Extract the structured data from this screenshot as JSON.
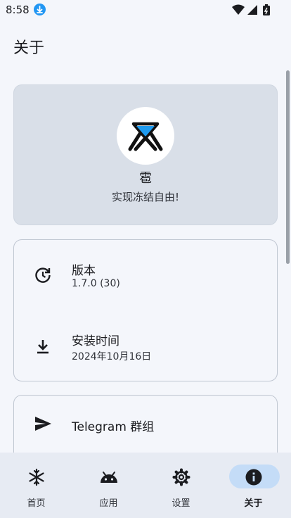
{
  "status": {
    "time": "8:58"
  },
  "header": {
    "title": "关于"
  },
  "hero": {
    "app_name": "雹",
    "slogan": "实现冻结自由!"
  },
  "info": {
    "version_label": "版本",
    "version_value": "1.7.0 (30)",
    "install_label": "安装时间",
    "install_value": "2024年10月16日"
  },
  "links": {
    "telegram_label": "Telegram 群组"
  },
  "nav": {
    "items": [
      {
        "label": "首页",
        "icon": "snowflake-icon"
      },
      {
        "label": "应用",
        "icon": "android-icon"
      },
      {
        "label": "设置",
        "icon": "gear-icon"
      },
      {
        "label": "关于",
        "icon": "info-icon",
        "active": true
      }
    ]
  },
  "colors": {
    "accent_pill": "#c4dcf7",
    "hero_bg": "#d9dfe8",
    "background": "#f4f6fb"
  }
}
